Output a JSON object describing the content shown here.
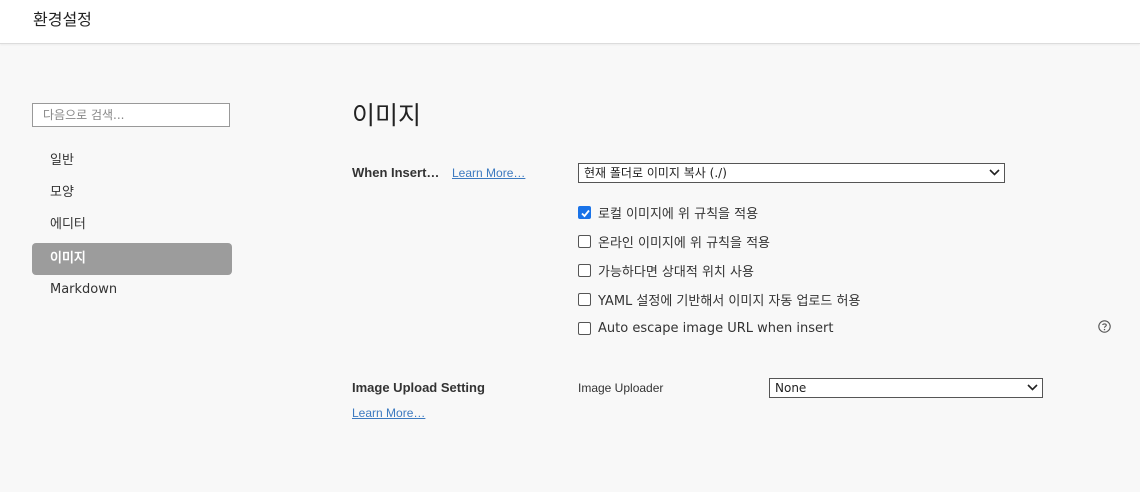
{
  "window": {
    "title": "환경설정"
  },
  "sidebar": {
    "search_placeholder": "다음으로 검색...",
    "items": [
      {
        "label": "일반",
        "active": false
      },
      {
        "label": "모양",
        "active": false
      },
      {
        "label": "에디터",
        "active": false
      },
      {
        "label": "이미지",
        "active": true
      },
      {
        "label": "Markdown",
        "active": false
      }
    ]
  },
  "main": {
    "heading": "이미지",
    "when_insert": {
      "label": "When Insert…",
      "learn_more": "Learn More…",
      "selected": "현재 폴더로 이미지 복사 (./)"
    },
    "options": [
      {
        "label": "로컬 이미지에 위 규칙을 적용",
        "checked": true
      },
      {
        "label": "온라인 이미지에 위 규칙을 적용",
        "checked": false
      },
      {
        "label": "가능하다면 상대적 위치 사용",
        "checked": false
      },
      {
        "label": "YAML 설정에 기반해서 이미지 자동 업로드 허용",
        "checked": false
      },
      {
        "label": "Auto escape image URL when insert",
        "checked": false
      }
    ],
    "upload": {
      "label": "Image Upload Setting",
      "learn_more": "Learn More…",
      "uploader_label": "Image Uploader",
      "uploader_value": "None"
    }
  },
  "colors": {
    "accent": "#1a73e8",
    "active_nav": "#9c9c9c",
    "link": "#3c7ac0"
  }
}
